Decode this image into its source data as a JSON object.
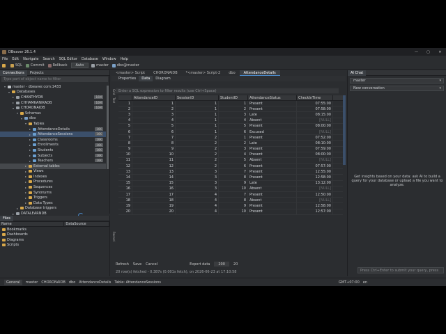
{
  "window": {
    "title": "DBeaver 26.1.4",
    "controls": [
      "—",
      "▢",
      "✕"
    ]
  },
  "menu": [
    "File",
    "Edit",
    "Navigate",
    "Search",
    "SQL Editor",
    "Database",
    "Window",
    "Help"
  ],
  "toolbar": {
    "sql": "SQL",
    "commit": "Commit",
    "rollback": "Rollback",
    "mode": "Auto",
    "catalog": "master",
    "schema": "dbo@master"
  },
  "left_tabs": {
    "connections": "Connections",
    "projects": "Projects"
  },
  "search_placeholder": "Type part of object name to filter",
  "tree": [
    {
      "label": "master - dbeaver.com:1433",
      "indent": 1,
      "arrow": "▾",
      "icon": "#c0c4c8"
    },
    {
      "label": "Databases",
      "indent": 2,
      "arrow": "▾",
      "icon": "#d8a84a"
    },
    {
      "label": "CHANTHYDB",
      "indent": 3,
      "arrow": "▸",
      "icon": "#9aa0a6",
      "size": "16M"
    },
    {
      "label": "CHHAMKANIKADB",
      "indent": 3,
      "arrow": "▸",
      "icon": "#9aa0a6",
      "size": "16M"
    },
    {
      "label": "CHORONAIDB",
      "indent": 3,
      "arrow": "▾",
      "icon": "#9aa0a6",
      "size": "16M"
    },
    {
      "label": "Schemas",
      "indent": 4,
      "arrow": "▾",
      "icon": "#d8a84a"
    },
    {
      "label": "dbo",
      "indent": 5,
      "arrow": "▾",
      "icon": "#7aa0c8"
    },
    {
      "label": "Tables",
      "indent": 6,
      "arrow": "▾",
      "icon": "#d8a84a"
    },
    {
      "label": "AttendanceDetails",
      "indent": 7,
      "arrow": "▸",
      "icon": "#6a9fd0",
      "size": "16K"
    },
    {
      "label": "AttendanceSessions",
      "indent": 7,
      "arrow": "▸",
      "icon": "#6a9fd0",
      "size": "16K",
      "selected": true
    },
    {
      "label": "Classrooms",
      "indent": 7,
      "arrow": "▸",
      "icon": "#6a9fd0",
      "size": "16K"
    },
    {
      "label": "Enrollments",
      "indent": 7,
      "arrow": "▸",
      "icon": "#6a9fd0",
      "size": "16K"
    },
    {
      "label": "Students",
      "indent": 7,
      "arrow": "▸",
      "icon": "#6a9fd0",
      "size": "16K"
    },
    {
      "label": "Subjects",
      "indent": 7,
      "arrow": "▸",
      "icon": "#6a9fd0",
      "size": "16K"
    },
    {
      "label": "Teachers",
      "indent": 7,
      "arrow": "▸",
      "icon": "#6a9fd0",
      "size": "16K"
    },
    {
      "label": "External tables",
      "indent": 6,
      "arrow": "▸",
      "icon": "#d8a84a",
      "hover": true
    },
    {
      "label": "Views",
      "indent": 6,
      "arrow": "▸",
      "icon": "#d8a84a"
    },
    {
      "label": "Indexes",
      "indent": 6,
      "arrow": "▸",
      "icon": "#d8a84a"
    },
    {
      "label": "Procedures",
      "indent": 6,
      "arrow": "▸",
      "icon": "#d8a84a"
    },
    {
      "label": "Sequences",
      "indent": 6,
      "arrow": "▸",
      "icon": "#d8a84a"
    },
    {
      "label": "Synonyms",
      "indent": 6,
      "arrow": "▸",
      "icon": "#d8a84a"
    },
    {
      "label": "Triggers",
      "indent": 6,
      "arrow": "▸",
      "icon": "#d8a84a"
    },
    {
      "label": "Data Types",
      "indent": 6,
      "arrow": "▸",
      "icon": "#d8a84a"
    },
    {
      "label": "Database triggers",
      "indent": 4,
      "arrow": "▸",
      "icon": "#d8a84a"
    },
    {
      "label": "DATALEARNDB",
      "indent": 3,
      "arrow": "▸",
      "icon": "#9aa0a6"
    }
  ],
  "files": {
    "title": "Files",
    "headers": [
      "Name",
      "DataSource"
    ],
    "folders": [
      "Bookmarks",
      "Dashboards",
      "Diagrams",
      "Scripts"
    ]
  },
  "editor_tabs": [
    "<master> Script",
    "CHORONAIDB",
    "*<master> Script-2",
    "dbo",
    "AttendanceDetails"
  ],
  "sub_tabs": [
    "Properties",
    "Data",
    "Diagram"
  ],
  "filter_placeholder": "Enter a SQL expression to filter results (use Ctrl+Space)",
  "side_labels": [
    "Grid",
    "Text",
    "Record"
  ],
  "grid": {
    "headers": [
      "",
      "AttendanceID",
      "SessionID",
      "StudentID",
      "AttendanceStatus",
      "CheckInTime"
    ],
    "rows": [
      [
        "1",
        "1",
        "1",
        "1",
        "Present",
        "07:55:00"
      ],
      [
        "2",
        "2",
        "1",
        "2",
        "Present",
        "07:58:00"
      ],
      [
        "3",
        "3",
        "1",
        "3",
        "Late",
        "08:15:00"
      ],
      [
        "4",
        "4",
        "1",
        "4",
        "Absent",
        "[NULL]"
      ],
      [
        "5",
        "5",
        "1",
        "5",
        "Present",
        "08:00:00"
      ],
      [
        "6",
        "6",
        "1",
        "6",
        "Excused",
        "[NULL]"
      ],
      [
        "7",
        "7",
        "2",
        "1",
        "Present",
        "07:52:00"
      ],
      [
        "8",
        "8",
        "2",
        "2",
        "Late",
        "08:10:00"
      ],
      [
        "9",
        "9",
        "2",
        "3",
        "Present",
        "07:59:00"
      ],
      [
        "10",
        "10",
        "2",
        "4",
        "Present",
        "08:00:00"
      ],
      [
        "11",
        "11",
        "2",
        "5",
        "Absent",
        "[NULL]"
      ],
      [
        "12",
        "12",
        "2",
        "6",
        "Present",
        "07:57:00"
      ],
      [
        "13",
        "13",
        "3",
        "7",
        "Present",
        "12:55:00"
      ],
      [
        "14",
        "14",
        "3",
        "8",
        "Present",
        "12:58:00"
      ],
      [
        "15",
        "15",
        "3",
        "9",
        "Late",
        "13:12:00"
      ],
      [
        "16",
        "16",
        "3",
        "10",
        "Absent",
        "[NULL]"
      ],
      [
        "17",
        "17",
        "4",
        "7",
        "Present",
        "12:50:00"
      ],
      [
        "18",
        "18",
        "4",
        "8",
        "Absent",
        "[NULL]"
      ],
      [
        "19",
        "19",
        "4",
        "9",
        "Present",
        "12:58:00"
      ],
      [
        "20",
        "20",
        "4",
        "10",
        "Present",
        "12:57:00"
      ]
    ]
  },
  "grid_bottom": {
    "refresh": "Refresh",
    "save": "Save",
    "cancel": "Cancel",
    "export": "Export data",
    "limit": "200",
    "count": "20"
  },
  "grid_status": "20 row(s) fetched - 0.387s (0.001s fetch), on 2026-06-23 at 17:10:58",
  "chat": {
    "title": "AI Chat",
    "connection": "master",
    "conversation": "New conversation",
    "message": "Get insights based on your data: ask AI to build a query for your database or upload a file you want to analyze.",
    "input_placeholder": "Press Ctrl+Enter to submit your query, press"
  },
  "statusbar": [
    "General",
    "master",
    "CHORONAIDB",
    "dbo",
    "AttendanceDetails",
    "Table: AttendanceSessions"
  ],
  "status_right": [
    "GMT+07:00",
    "en"
  ]
}
